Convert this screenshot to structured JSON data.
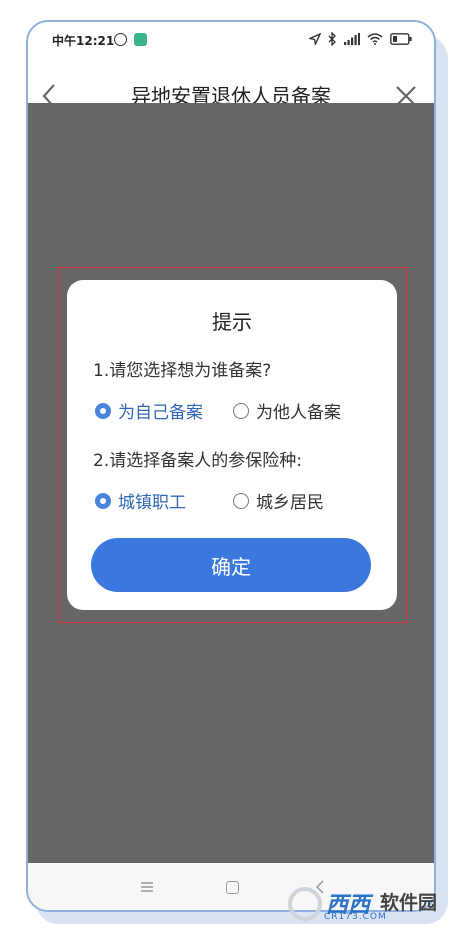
{
  "status_bar": {
    "time": "中午12:21"
  },
  "header": {
    "title": "异地安置退休人员备案"
  },
  "dialog": {
    "title": "提示",
    "question1": "1.请您选择想为谁备案?",
    "question1_options": [
      {
        "label": "为自己备案",
        "selected": true
      },
      {
        "label": "为他人备案",
        "selected": false
      }
    ],
    "question2": "2.请选择备案人的参保险种:",
    "question2_options": [
      {
        "label": "城镇职工",
        "selected": true
      },
      {
        "label": "城乡居民",
        "selected": false
      }
    ],
    "confirm_label": "确定"
  },
  "watermark": {
    "brand": "西西",
    "name": "软件园",
    "url": "CR173.COM"
  },
  "colors": {
    "accent": "#3b78de",
    "overlay": "#666666",
    "frame": "#d9323b",
    "selected_text": "#2f66b8"
  }
}
